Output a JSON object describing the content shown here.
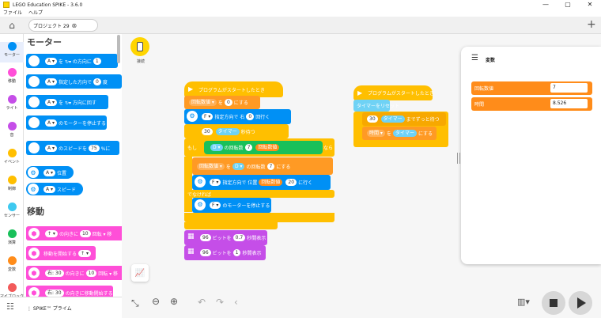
{
  "window": {
    "title": "LEGO Education SPIKE - 3.6.0",
    "controls": [
      "—",
      "▢",
      "✕"
    ]
  },
  "menu": [
    "ファイル",
    "ヘルプ"
  ],
  "tab": {
    "label": "プロジェクト 29",
    "add": "+"
  },
  "categories": [
    {
      "name": "モーター",
      "color": "#0090f5"
    },
    {
      "name": "移動",
      "color": "#ff4fd8"
    },
    {
      "name": "ライト",
      "color": "#c54ee8"
    },
    {
      "name": "音",
      "color": "#c54ee8"
    },
    {
      "name": "イベント",
      "color": "#ffbf00"
    },
    {
      "name": "制御",
      "color": "#ffbf00"
    },
    {
      "name": "センサー",
      "color": "#3ec9f0"
    },
    {
      "name": "演算",
      "color": "#19c05a"
    },
    {
      "name": "変数",
      "color": "#ff8c1a"
    },
    {
      "name": "マイブロック",
      "color": "#f25a5a"
    }
  ],
  "palette": {
    "motor_heading": "モーター",
    "move_heading": "移動",
    "motor_blocks": [
      {
        "port": "A ▾",
        "text": "を ↻▾ の方向に",
        "value": "1",
        "tail": ""
      },
      {
        "port": "A ▾",
        "text": "指定した方向で",
        "value": "0",
        "tail": "度"
      },
      {
        "port": "A ▾",
        "text": "を ↻▾ 方向に回す",
        "value": "",
        "tail": ""
      },
      {
        "port": "A ▾",
        "text": "のモーターを停止する",
        "value": "",
        "tail": ""
      },
      {
        "port": "A ▾",
        "text": "のスピードを",
        "value": "75",
        "tail": "%に"
      }
    ],
    "motor_reporters": [
      {
        "port": "A ▾",
        "text": "位置"
      },
      {
        "port": "A ▾",
        "text": "スピード"
      }
    ],
    "move_blocks": [
      {
        "dir": "↑ ▾",
        "text": "の向きに",
        "value": "10",
        "tail": "回転 ▾ 移"
      },
      {
        "dir": "",
        "text": "移動を開始する",
        "value": "↑ ▾",
        "tail": ""
      },
      {
        "dir": "右: 30",
        "text": "の向きに",
        "value": "10",
        "tail": "回転 ▾ 移"
      },
      {
        "dir": "右: 30",
        "text": "の向きに移動開始する",
        "value": "",
        "tail": ""
      }
    ],
    "footer": "SPIKE™ プライム"
  },
  "canvas": {
    "hub_label": "接続",
    "script1": {
      "hat": "プログラムがスタートしたとき",
      "set_var": {
        "text": "回転数値 ▾",
        "op": "を",
        "value": "0",
        "tail": "にする"
      },
      "motor_run": {
        "port": "F ▾",
        "text": "指定方向で",
        "pre": "右",
        "value": "0",
        "tail": "回行く"
      },
      "wait": {
        "value": "30",
        "text": "タイマー",
        "tail": "秒待つ"
      },
      "if": {
        "kw": "もし",
        "sensor": "D ▾",
        "cond": "の回転数",
        "value": "7",
        "var": "回転数値",
        "then": "なら"
      },
      "inner_set": {
        "text": "回転数値 ▾",
        "op": "を",
        "sensor": "D ▾",
        "cond": "の回転数",
        "value": "7",
        "tail": "にする"
      },
      "inner_motor": {
        "port": "F ▾",
        "text": "指定方向で",
        "pre": "位置",
        "var": "回転数値",
        "value": "20",
        "tail": "に行く"
      },
      "else": "でなければ",
      "stop": {
        "port": "F ▾",
        "text": "のモーターを停止する"
      },
      "light1": {
        "value": "96",
        "text": "ビットを",
        "value2": "0.7",
        "tail": "秒間表示"
      },
      "light2": {
        "value": "96",
        "text": "ビットを",
        "value2": "1",
        "tail": "秒間表示"
      }
    },
    "script2": {
      "hat": "プログラムがスタートしたとき",
      "reset": "タイマーをリセット",
      "wait": {
        "value": "30",
        "text": "タイマー",
        "tail": "までずっと待つ"
      },
      "set": {
        "text": "時間 ▾",
        "op": "を",
        "value": "タイマー",
        "tail": "にする"
      }
    }
  },
  "variables": {
    "title": "変数",
    "items": [
      {
        "name": "回転数値",
        "value": "7"
      },
      {
        "name": "時間",
        "value": "8.526"
      }
    ]
  },
  "toolbar": {
    "undo": "↶",
    "redo": "↷",
    "collapse": "‹"
  }
}
